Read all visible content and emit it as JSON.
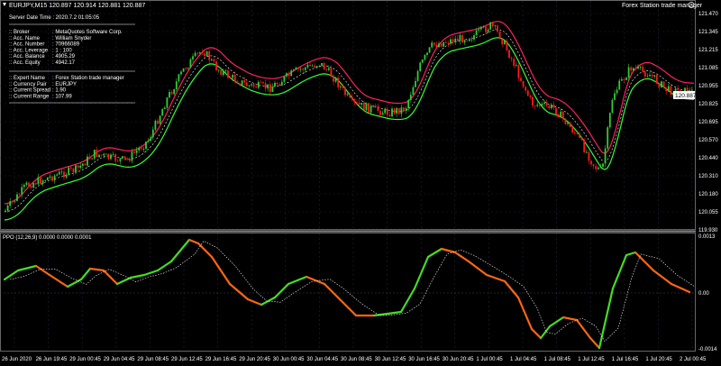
{
  "chart_header": "EURJPY,M15  120.897 120.914 120.881 120.887",
  "ea_title": "Forex Station trade manager",
  "info": {
    "server_time": "Server Date Time : 2020.7.2     01:05:05",
    "rows": [
      {
        "label": "Broker",
        "value": "MetaQuotes Software Corp."
      },
      {
        "label": "Acc. Name",
        "value": "William Snyder"
      },
      {
        "label": "Acc. Number",
        "value": "70966089"
      },
      {
        "label": "Acc. Leverage",
        "value": "1 : 100"
      },
      {
        "label": "Acc. Balance",
        "value": "4905.29"
      },
      {
        "label": "Acc. Equity",
        "value": "4942.17"
      }
    ],
    "rows2": [
      {
        "label": "Expert Name",
        "value": "Forex Station trade manager"
      },
      {
        "label": "Currency Pair",
        "value": "EURJPY"
      },
      {
        "label": "Current Spread",
        "value": "1.90"
      },
      {
        "label": "Current Range",
        "value": "107.99"
      }
    ]
  },
  "price_axis": [
    "121.470",
    "121.345",
    "121.215",
    "121.085",
    "120.955",
    "120.825",
    "120.695",
    "120.570",
    "120.440",
    "120.310",
    "120.180",
    "120.055",
    "119.930"
  ],
  "current_price": "120.887",
  "oscillator_label": "PPO (12,26,9) 0.0000 0.0000 0.0001",
  "osc_axis": [
    "0.0013",
    "0.00",
    "-0.0014"
  ],
  "time_axis": [
    "26 Jun 2020",
    "26 Jun 19:45",
    "29 Jun 00:45",
    "29 Jun 04:45",
    "29 Jun 08:45",
    "29 Jun 12:45",
    "29 Jun 16:45",
    "29 Jun 20:45",
    "30 Jun 00:45",
    "30 Jun 04:45",
    "30 Jun 08:45",
    "30 Jun 12:45",
    "30 Jun 16:45",
    "30 Jun 20:45",
    "1 Jul 00:45",
    "1 Jul 04:45",
    "1 Jul 08:45",
    "1 Jul 12:45",
    "1 Jul 16:45",
    "1 Jul 20:45",
    "2 Jul 00:45"
  ],
  "colors": {
    "bull": "#33cc33",
    "bear": "#ff1a1a",
    "band_upper": "#ff2060",
    "band_lower": "#33ff33",
    "mid": "#ffffff",
    "ppo_up": "#44dd22",
    "ppo_down": "#ff6611",
    "signal": "#ffffff",
    "grid": "#22223a"
  }
}
